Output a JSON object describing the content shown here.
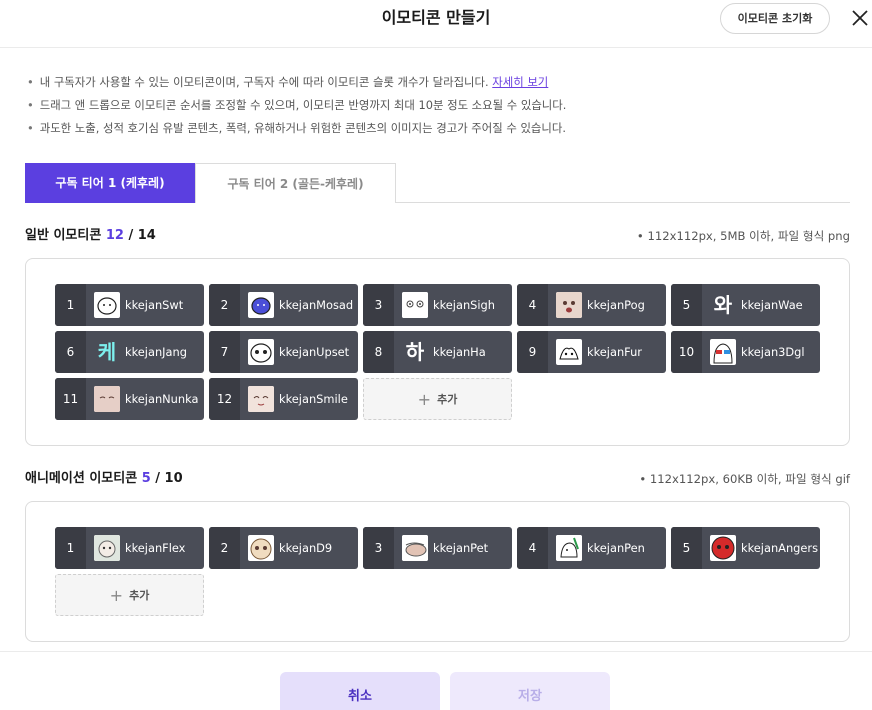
{
  "header": {
    "title": "이모티콘 만들기",
    "reset_label": "이모티콘 초기화"
  },
  "notices": {
    "line1": "내 구독자가 사용할 수 있는 이모티콘이며, 구독자 수에 따라 이모티콘 슬롯 개수가 달라집니다.",
    "line1_link": "자세히 보기",
    "line2": "드래그 앤 드롭으로 이모티콘 순서를 조정할 수 있으며, 이모티콘 반영까지 최대 10분 정도 소요될 수 있습니다.",
    "line3": "과도한 노출, 성적 호기심 유발 콘텐츠, 폭력, 유해하거나 위험한 콘텐츠의 이미지는 경고가 주어질 수 있습니다."
  },
  "tabs": [
    {
      "label": "구독 티어 1 (케후레)"
    },
    {
      "label": "구독 티어 2 (골든-케후레)"
    }
  ],
  "general": {
    "label": "일반 이모티콘",
    "used": "12",
    "max": "/ 14",
    "spec": "112x112px, 5MB 이하, 파일 형식 png",
    "add_label": "추가",
    "items": [
      {
        "num": "1",
        "name": "kkejanSwt",
        "icon": "white-blob-icon"
      },
      {
        "num": "2",
        "name": "kkejanMosad",
        "icon": "blue-blob-icon"
      },
      {
        "num": "3",
        "name": "kkejanSigh",
        "icon": "sigh-face-icon"
      },
      {
        "num": "4",
        "name": "kkejanPog",
        "icon": "pog-face-icon"
      },
      {
        "num": "5",
        "name": "kkejanWae",
        "icon": "wae-text-icon",
        "glyph": "와"
      },
      {
        "num": "6",
        "name": "kkejanJang",
        "icon": "jang-text-icon",
        "glyph": "케"
      },
      {
        "num": "7",
        "name": "kkejanUpset",
        "icon": "upset-face-icon"
      },
      {
        "num": "8",
        "name": "kkejanHa",
        "icon": "ha-text-icon",
        "glyph": "하"
      },
      {
        "num": "9",
        "name": "kkejanFur",
        "icon": "fur-cat-icon"
      },
      {
        "num": "10",
        "name": "kkejan3Dgl",
        "icon": "3d-glasses-icon"
      },
      {
        "num": "11",
        "name": "kkejanNunka",
        "icon": "nunka-face-icon"
      },
      {
        "num": "12",
        "name": "kkejanSmile",
        "icon": "smile-face-icon"
      }
    ]
  },
  "animated": {
    "label": "애니메이션 이모티콘",
    "used": "5",
    "max": "/ 10",
    "spec": "112x112px, 60KB 이하, 파일 형식 gif",
    "add_label": "추가",
    "items": [
      {
        "num": "1",
        "name": "kkejanFlex",
        "icon": "flex-face-icon"
      },
      {
        "num": "2",
        "name": "kkejanD9",
        "icon": "d9-face-icon"
      },
      {
        "num": "3",
        "name": "kkejanPet",
        "icon": "pet-hand-icon"
      },
      {
        "num": "4",
        "name": "kkejanPen",
        "icon": "pen-face-icon"
      },
      {
        "num": "5",
        "name": "kkejanAngers",
        "icon": "angry-red-icon"
      }
    ]
  },
  "footer": {
    "cancel_label": "취소",
    "save_label": "저장"
  },
  "colors": {
    "accent": "#5b3fe0",
    "slot_bg": "#4a4d57",
    "cancel_bg": "#e5dffb"
  }
}
